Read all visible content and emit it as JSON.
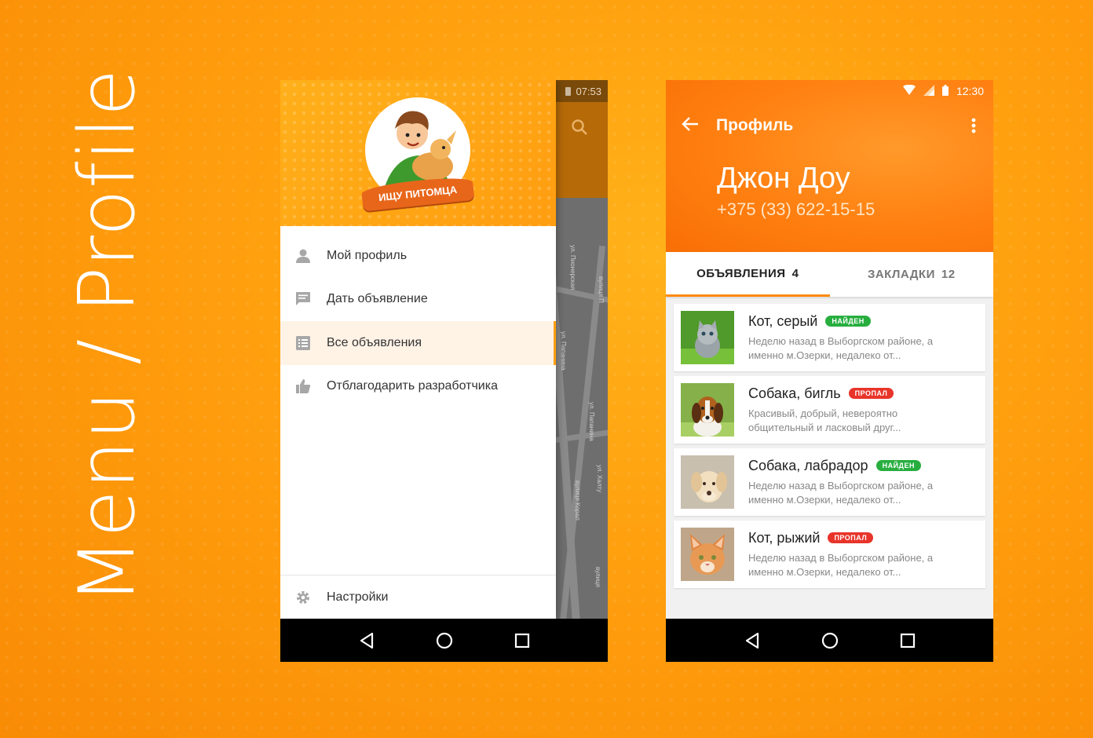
{
  "side_title": "Menu / Profile",
  "menu_screen": {
    "status_time": "07:53",
    "logo_text": "ИЩУ ПИТОМЦА",
    "items": [
      {
        "label": "Мой профиль",
        "icon": "person-icon"
      },
      {
        "label": "Дать объявление",
        "icon": "message-icon"
      },
      {
        "label": "Все объявления",
        "icon": "list-icon",
        "active": true
      },
      {
        "label": "Отблагодарить разработчика",
        "icon": "thumb-up-icon"
      }
    ],
    "settings_label": "Настройки",
    "map_labels": [
      "ул. Пионерская",
      "вулиця П",
      "ул. Папанина",
      "ул. Папанина",
      "ул. Халту",
      "вулиця Корал",
      "вулиця"
    ],
    "fab_label": "+"
  },
  "profile_screen": {
    "status_time": "12:30",
    "title": "Профиль",
    "name": "Джон Доу",
    "phone": "+375 (33) 622-15-15",
    "tabs": [
      {
        "label": "ОБЪЯВЛЕНИЯ",
        "count": "4",
        "active": true
      },
      {
        "label": "ЗАКЛАДКИ",
        "count": "12",
        "active": false
      }
    ],
    "cards": [
      {
        "title": "Кот, серый",
        "badge": "НАЙДЕН",
        "badge_color": "#27ae3f",
        "text": "Неделю назад в Выборгском районе, а именно м.Озерки, недалеко от..."
      },
      {
        "title": "Собака, бигль",
        "badge": "ПРОПАЛ",
        "badge_color": "#e8342a",
        "text": "Красивый, добрый, невероятно общительный и ласковый друг..."
      },
      {
        "title": "Собака, лабрадор",
        "badge": "НАЙДЕН",
        "badge_color": "#27ae3f",
        "text": "Неделю назад в Выборгском районе, а именно м.Озерки, недалеко от..."
      },
      {
        "title": "Кот, рыжий",
        "badge": "ПРОПАЛ",
        "badge_color": "#e8342a",
        "text": "Неделю назад в Выборгском районе, а именно м.Озерки, недалеко от..."
      }
    ]
  },
  "colors": {
    "accent": "#ff8a10",
    "found": "#27ae3f",
    "lost": "#e8342a"
  }
}
